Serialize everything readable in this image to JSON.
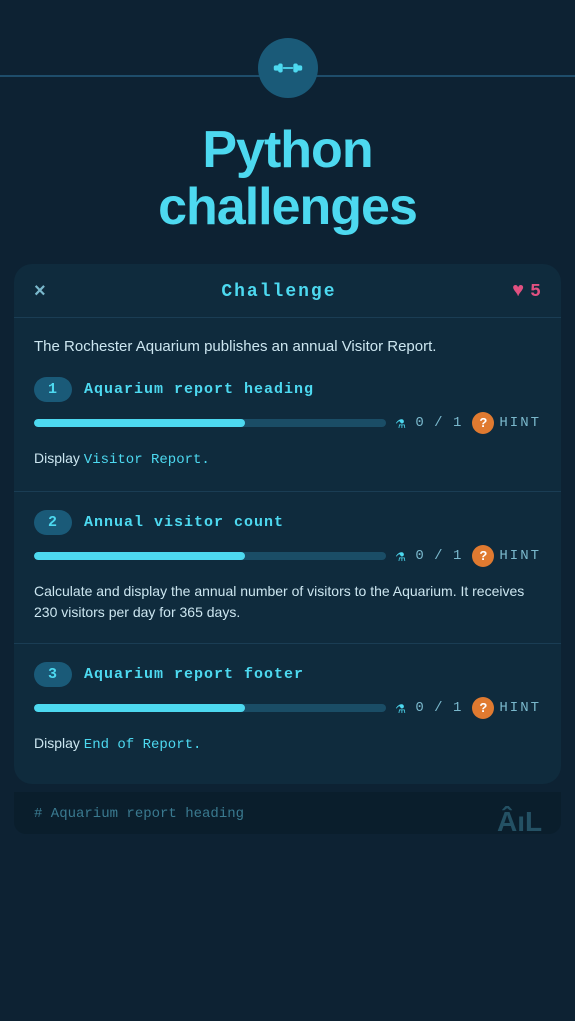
{
  "header": {
    "title": "Python\nchallenges",
    "icon_label": "dumbbell-icon"
  },
  "card": {
    "close_label": "×",
    "card_title": "Challenge",
    "hearts": {
      "count": "5",
      "icon": "♥"
    },
    "description": "The Rochester Aquarium publishes an annual Visitor Report."
  },
  "challenges": [
    {
      "number": "1",
      "name": "Aquarium report heading",
      "score": "0 / 1",
      "hint_label": "HINT",
      "sub_desc_prefix": "Display ",
      "sub_desc_code": "Visitor Report.",
      "sub_desc_suffix": ""
    },
    {
      "number": "2",
      "name": "Annual visitor count",
      "score": "0 / 1",
      "hint_label": "HINT",
      "sub_desc_prefix": "Calculate and display the annual number of visitors to the Aquarium. It receives 230 visitors per day for 365 days.",
      "sub_desc_code": "",
      "sub_desc_suffix": ""
    },
    {
      "number": "3",
      "name": "Aquarium report footer",
      "score": "0 / 1",
      "hint_label": "HINT",
      "sub_desc_prefix": "Display ",
      "sub_desc_code": "End of Report.",
      "sub_desc_suffix": ""
    }
  ],
  "code_hint": "# Aquarium report heading"
}
